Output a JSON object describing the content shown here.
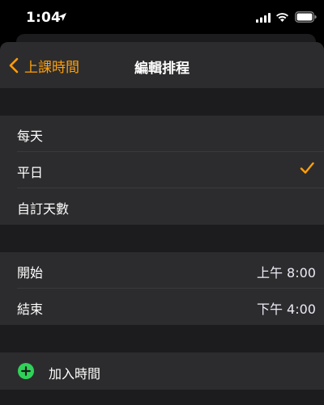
{
  "status_bar": {
    "time": "1:04"
  },
  "nav": {
    "back_label": "上課時間",
    "title": "編輯排程"
  },
  "repeat_options": [
    {
      "label": "每天",
      "selected": false
    },
    {
      "label": "平日",
      "selected": true
    },
    {
      "label": "自訂天數",
      "selected": false
    }
  ],
  "time_settings": [
    {
      "label": "開始",
      "value": "上午 8:00"
    },
    {
      "label": "結束",
      "value": "下午 4:00"
    }
  ],
  "add_time": {
    "label": "加入時間"
  },
  "colors": {
    "accent": "#ff9f0a",
    "add_green": "#30d158"
  }
}
